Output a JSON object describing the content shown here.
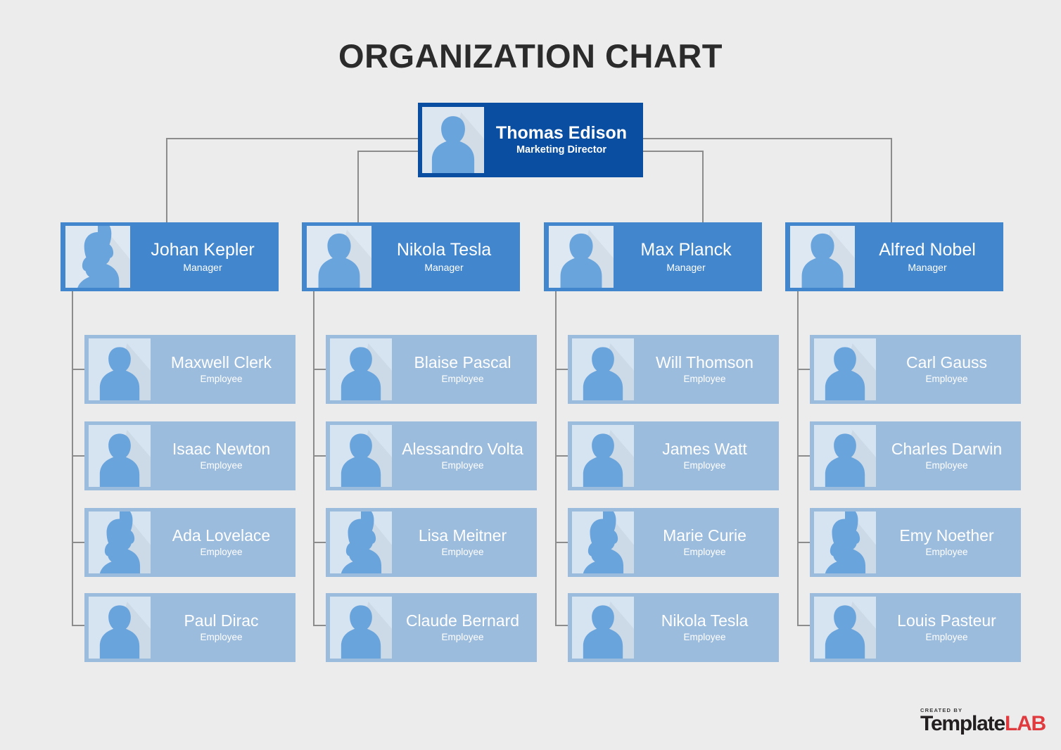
{
  "page": {
    "title": "ORGANIZATION CHART",
    "background_color": "#ececec"
  },
  "colors": {
    "director_box": "#0a4ea2",
    "manager_box": "#4286cd",
    "employee_box": "#9cbcdd",
    "connector_line": "#8c8c8c",
    "title_text": "#2b2b2b",
    "node_text": "#ffffff",
    "logo_red": "#e03a3e",
    "logo_dark": "#231f20"
  },
  "org": {
    "director": {
      "name": "Thomas Edison",
      "role": "Marketing Director",
      "avatar": "male-avatar-icon"
    },
    "branches": [
      {
        "manager": {
          "name": "Johan Kepler",
          "role": "Manager",
          "avatar": "female-avatar-icon"
        },
        "employees": [
          {
            "name": "Maxwell Clerk",
            "role": "Employee",
            "avatar": "male-avatar-icon"
          },
          {
            "name": "Isaac Newton",
            "role": "Employee",
            "avatar": "male-avatar-icon"
          },
          {
            "name": "Ada Lovelace",
            "role": "Employee",
            "avatar": "female-avatar-icon"
          },
          {
            "name": "Paul Dirac",
            "role": "Employee",
            "avatar": "male-avatar-icon"
          }
        ]
      },
      {
        "manager": {
          "name": "Nikola Tesla",
          "role": "Manager",
          "avatar": "male-avatar-icon"
        },
        "employees": [
          {
            "name": "Blaise Pascal",
            "role": "Employee",
            "avatar": "male-avatar-icon"
          },
          {
            "name": "Alessandro Volta",
            "role": "Employee",
            "avatar": "male-avatar-icon"
          },
          {
            "name": "Lisa Meitner",
            "role": "Employee",
            "avatar": "female-avatar-icon"
          },
          {
            "name": "Claude Bernard",
            "role": "Employee",
            "avatar": "male-avatar-icon"
          }
        ]
      },
      {
        "manager": {
          "name": "Max Planck",
          "role": "Manager",
          "avatar": "male-avatar-icon"
        },
        "employees": [
          {
            "name": "Will Thomson",
            "role": "Employee",
            "avatar": "male-avatar-icon"
          },
          {
            "name": "James Watt",
            "role": "Employee",
            "avatar": "male-avatar-icon"
          },
          {
            "name": "Marie Curie",
            "role": "Employee",
            "avatar": "female-avatar-icon"
          },
          {
            "name": "Nikola Tesla",
            "role": "Employee",
            "avatar": "male-avatar-icon"
          }
        ]
      },
      {
        "manager": {
          "name": "Alfred Nobel",
          "role": "Manager",
          "avatar": "male-avatar-icon"
        },
        "employees": [
          {
            "name": "Carl Gauss",
            "role": "Employee",
            "avatar": "male-avatar-icon"
          },
          {
            "name": "Charles Darwin",
            "role": "Employee",
            "avatar": "male-avatar-icon"
          },
          {
            "name": "Emy Noether",
            "role": "Employee",
            "avatar": "female-avatar-icon"
          },
          {
            "name": "Louis Pasteur",
            "role": "Employee",
            "avatar": "male-avatar-icon"
          }
        ]
      }
    ]
  },
  "logo": {
    "created_by": "CREATED BY",
    "template": "Template",
    "lab": "LAB"
  }
}
